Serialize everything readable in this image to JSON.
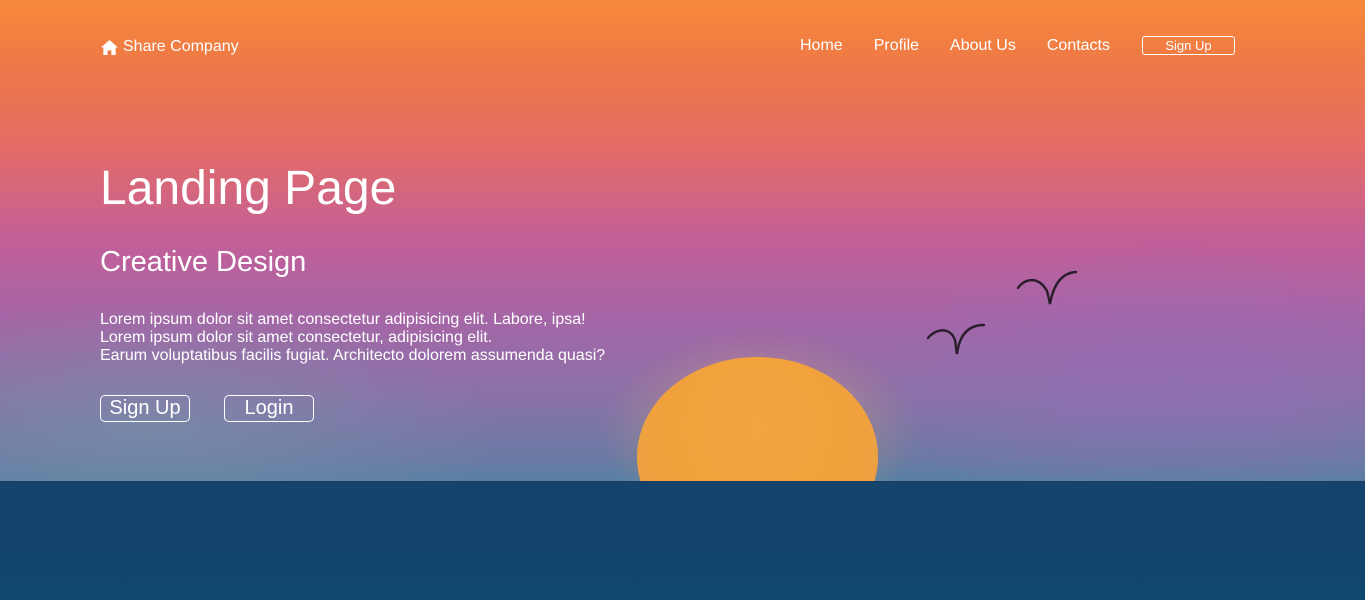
{
  "brand": {
    "name": "Share Company",
    "icon": "home-icon"
  },
  "nav": {
    "links": [
      "Home",
      "Profile",
      "About Us",
      "Contacts"
    ],
    "signup_label": "Sign Up"
  },
  "hero": {
    "title": "Landing Page",
    "subtitle": "Creative Design",
    "lines": [
      "Lorem ipsum dolor sit amet consectetur adipisicing elit. Labore, ipsa!",
      "Lorem ipsum dolor sit amet consectetur, adipisicing elit.",
      "Earum voluptatibus facilis fugiat. Architecto dolorem assumenda quasi?"
    ],
    "signup_label": "Sign Up",
    "login_label": "Login"
  },
  "colors": {
    "sky_top": "#f7893a",
    "sky_mid": "#c35f98",
    "sun": "#f0a13c",
    "sea": "#14436e",
    "text": "#ffffff"
  }
}
